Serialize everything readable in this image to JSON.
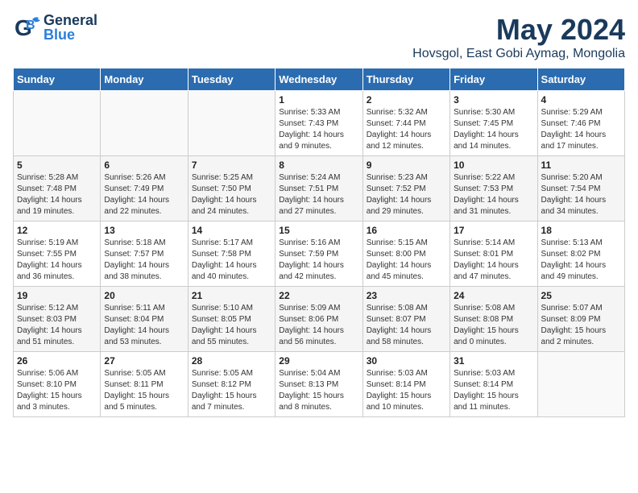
{
  "header": {
    "logo": {
      "general": "General",
      "blue": "Blue"
    },
    "month": "May 2024",
    "location": "Hovsgol, East Gobi Aymag, Mongolia"
  },
  "weekdays": [
    "Sunday",
    "Monday",
    "Tuesday",
    "Wednesday",
    "Thursday",
    "Friday",
    "Saturday"
  ],
  "weeks": [
    [
      {
        "day": "",
        "info": ""
      },
      {
        "day": "",
        "info": ""
      },
      {
        "day": "",
        "info": ""
      },
      {
        "day": "1",
        "info": "Sunrise: 5:33 AM\nSunset: 7:43 PM\nDaylight: 14 hours\nand 9 minutes."
      },
      {
        "day": "2",
        "info": "Sunrise: 5:32 AM\nSunset: 7:44 PM\nDaylight: 14 hours\nand 12 minutes."
      },
      {
        "day": "3",
        "info": "Sunrise: 5:30 AM\nSunset: 7:45 PM\nDaylight: 14 hours\nand 14 minutes."
      },
      {
        "day": "4",
        "info": "Sunrise: 5:29 AM\nSunset: 7:46 PM\nDaylight: 14 hours\nand 17 minutes."
      }
    ],
    [
      {
        "day": "5",
        "info": "Sunrise: 5:28 AM\nSunset: 7:48 PM\nDaylight: 14 hours\nand 19 minutes."
      },
      {
        "day": "6",
        "info": "Sunrise: 5:26 AM\nSunset: 7:49 PM\nDaylight: 14 hours\nand 22 minutes."
      },
      {
        "day": "7",
        "info": "Sunrise: 5:25 AM\nSunset: 7:50 PM\nDaylight: 14 hours\nand 24 minutes."
      },
      {
        "day": "8",
        "info": "Sunrise: 5:24 AM\nSunset: 7:51 PM\nDaylight: 14 hours\nand 27 minutes."
      },
      {
        "day": "9",
        "info": "Sunrise: 5:23 AM\nSunset: 7:52 PM\nDaylight: 14 hours\nand 29 minutes."
      },
      {
        "day": "10",
        "info": "Sunrise: 5:22 AM\nSunset: 7:53 PM\nDaylight: 14 hours\nand 31 minutes."
      },
      {
        "day": "11",
        "info": "Sunrise: 5:20 AM\nSunset: 7:54 PM\nDaylight: 14 hours\nand 34 minutes."
      }
    ],
    [
      {
        "day": "12",
        "info": "Sunrise: 5:19 AM\nSunset: 7:55 PM\nDaylight: 14 hours\nand 36 minutes."
      },
      {
        "day": "13",
        "info": "Sunrise: 5:18 AM\nSunset: 7:57 PM\nDaylight: 14 hours\nand 38 minutes."
      },
      {
        "day": "14",
        "info": "Sunrise: 5:17 AM\nSunset: 7:58 PM\nDaylight: 14 hours\nand 40 minutes."
      },
      {
        "day": "15",
        "info": "Sunrise: 5:16 AM\nSunset: 7:59 PM\nDaylight: 14 hours\nand 42 minutes."
      },
      {
        "day": "16",
        "info": "Sunrise: 5:15 AM\nSunset: 8:00 PM\nDaylight: 14 hours\nand 45 minutes."
      },
      {
        "day": "17",
        "info": "Sunrise: 5:14 AM\nSunset: 8:01 PM\nDaylight: 14 hours\nand 47 minutes."
      },
      {
        "day": "18",
        "info": "Sunrise: 5:13 AM\nSunset: 8:02 PM\nDaylight: 14 hours\nand 49 minutes."
      }
    ],
    [
      {
        "day": "19",
        "info": "Sunrise: 5:12 AM\nSunset: 8:03 PM\nDaylight: 14 hours\nand 51 minutes."
      },
      {
        "day": "20",
        "info": "Sunrise: 5:11 AM\nSunset: 8:04 PM\nDaylight: 14 hours\nand 53 minutes."
      },
      {
        "day": "21",
        "info": "Sunrise: 5:10 AM\nSunset: 8:05 PM\nDaylight: 14 hours\nand 55 minutes."
      },
      {
        "day": "22",
        "info": "Sunrise: 5:09 AM\nSunset: 8:06 PM\nDaylight: 14 hours\nand 56 minutes."
      },
      {
        "day": "23",
        "info": "Sunrise: 5:08 AM\nSunset: 8:07 PM\nDaylight: 14 hours\nand 58 minutes."
      },
      {
        "day": "24",
        "info": "Sunrise: 5:08 AM\nSunset: 8:08 PM\nDaylight: 15 hours\nand 0 minutes."
      },
      {
        "day": "25",
        "info": "Sunrise: 5:07 AM\nSunset: 8:09 PM\nDaylight: 15 hours\nand 2 minutes."
      }
    ],
    [
      {
        "day": "26",
        "info": "Sunrise: 5:06 AM\nSunset: 8:10 PM\nDaylight: 15 hours\nand 3 minutes."
      },
      {
        "day": "27",
        "info": "Sunrise: 5:05 AM\nSunset: 8:11 PM\nDaylight: 15 hours\nand 5 minutes."
      },
      {
        "day": "28",
        "info": "Sunrise: 5:05 AM\nSunset: 8:12 PM\nDaylight: 15 hours\nand 7 minutes."
      },
      {
        "day": "29",
        "info": "Sunrise: 5:04 AM\nSunset: 8:13 PM\nDaylight: 15 hours\nand 8 minutes."
      },
      {
        "day": "30",
        "info": "Sunrise: 5:03 AM\nSunset: 8:14 PM\nDaylight: 15 hours\nand 10 minutes."
      },
      {
        "day": "31",
        "info": "Sunrise: 5:03 AM\nSunset: 8:14 PM\nDaylight: 15 hours\nand 11 minutes."
      },
      {
        "day": "",
        "info": ""
      }
    ]
  ]
}
